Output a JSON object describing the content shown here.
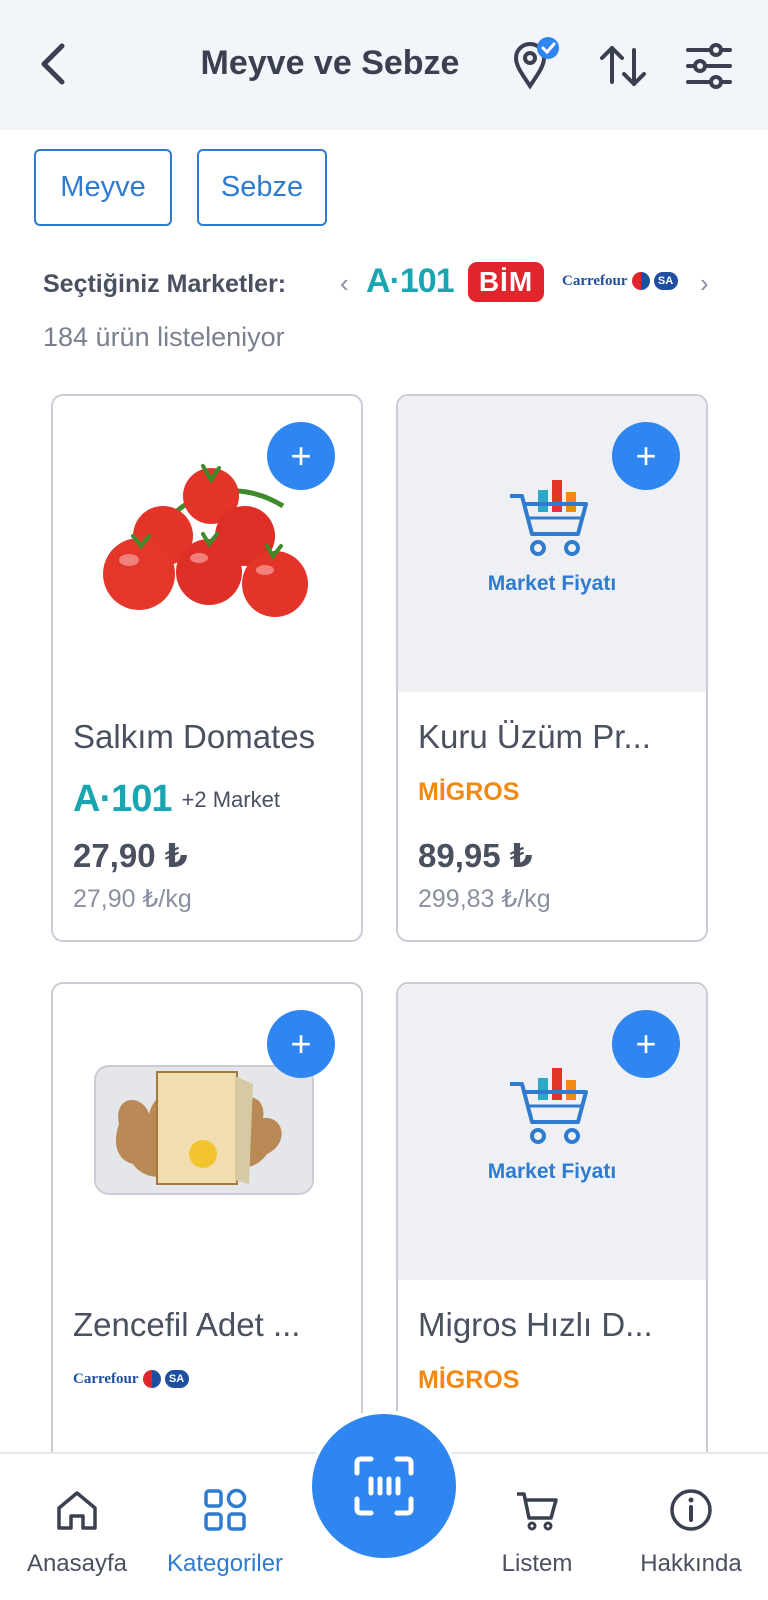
{
  "header": {
    "title": "Meyve ve Sebze",
    "icons": [
      "back-arrow-icon",
      "location-verified-icon",
      "sort-icon",
      "filter-sliders-icon"
    ]
  },
  "chips": [
    {
      "label": "Meyve"
    },
    {
      "label": "Sebze"
    }
  ],
  "markets": {
    "label": "Seçtiğiniz Marketler:",
    "logos": {
      "a101": "A·101",
      "bim": "BİM",
      "carrefour": "Carrefour",
      "sa": "SA"
    }
  },
  "product_count": "184 ürün listeleniyor",
  "products": [
    {
      "name": "Salkım Domates",
      "market": "A·101",
      "more": "+2 Market",
      "price": "27,90 ₺",
      "unit_price": "27,90 ₺/kg",
      "image": "tomato-photo"
    },
    {
      "name": "Kuru Üzüm Pr...",
      "market": "MİGROS",
      "price": "89,95 ₺",
      "unit_price": "299,83 ₺/kg",
      "image": "market-fiyati-placeholder",
      "placeholder_label": "Market Fiyatı"
    },
    {
      "name": "Zencefil Adet ...",
      "market": "Carrefour",
      "market_sa": "SA",
      "image": "ginger-photo"
    },
    {
      "name": "Migros Hızlı D...",
      "market": "MİGROS",
      "image": "market-fiyati-placeholder",
      "placeholder_label": "Market Fiyatı"
    }
  ],
  "add_button_label": "+",
  "bottom_nav": [
    {
      "label": "Anasayfa",
      "icon": "home-icon"
    },
    {
      "label": "Kategoriler",
      "icon": "grid-icon",
      "active": true
    },
    {
      "label": "Listem",
      "icon": "cart-icon"
    },
    {
      "label": "Hakkında",
      "icon": "info-icon"
    }
  ],
  "colors": {
    "accent": "#2f86f0",
    "a101": "#19a6b0",
    "bim": "#e0262c",
    "migros": "#f08a14",
    "carrefour": "#1e4fa0"
  }
}
